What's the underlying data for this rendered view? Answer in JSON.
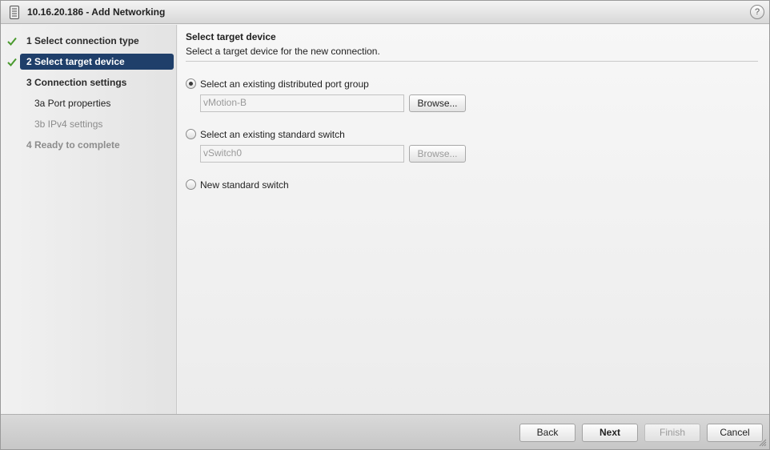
{
  "window": {
    "title": "10.16.20.186 - Add Networking",
    "help_label": "?"
  },
  "nav": {
    "steps": [
      {
        "label": "1  Select connection type",
        "completed": true
      },
      {
        "label": "2  Select target device",
        "completed": true,
        "active": true
      },
      {
        "label": "3  Connection settings"
      },
      {
        "label": "3a  Port properties"
      },
      {
        "label": "3b  IPv4 settings",
        "disabled": true
      },
      {
        "label": "4  Ready to complete",
        "disabled": true
      }
    ]
  },
  "main": {
    "title": "Select target device",
    "description": "Select a target device for the new connection.",
    "options": [
      {
        "label": "Select an existing distributed port group",
        "selected": true,
        "value": "vMotion-B",
        "browse_label": "Browse..."
      },
      {
        "label": "Select an existing standard switch",
        "selected": false,
        "value": "vSwitch0",
        "browse_label": "Browse..."
      },
      {
        "label": "New standard switch",
        "selected": false
      }
    ]
  },
  "footer": {
    "back_label": "Back",
    "next_label": "Next",
    "finish_label": "Finish",
    "cancel_label": "Cancel"
  },
  "colors": {
    "active_step_bg": "#1f3f6a",
    "check_green": "#4a9a2e"
  }
}
